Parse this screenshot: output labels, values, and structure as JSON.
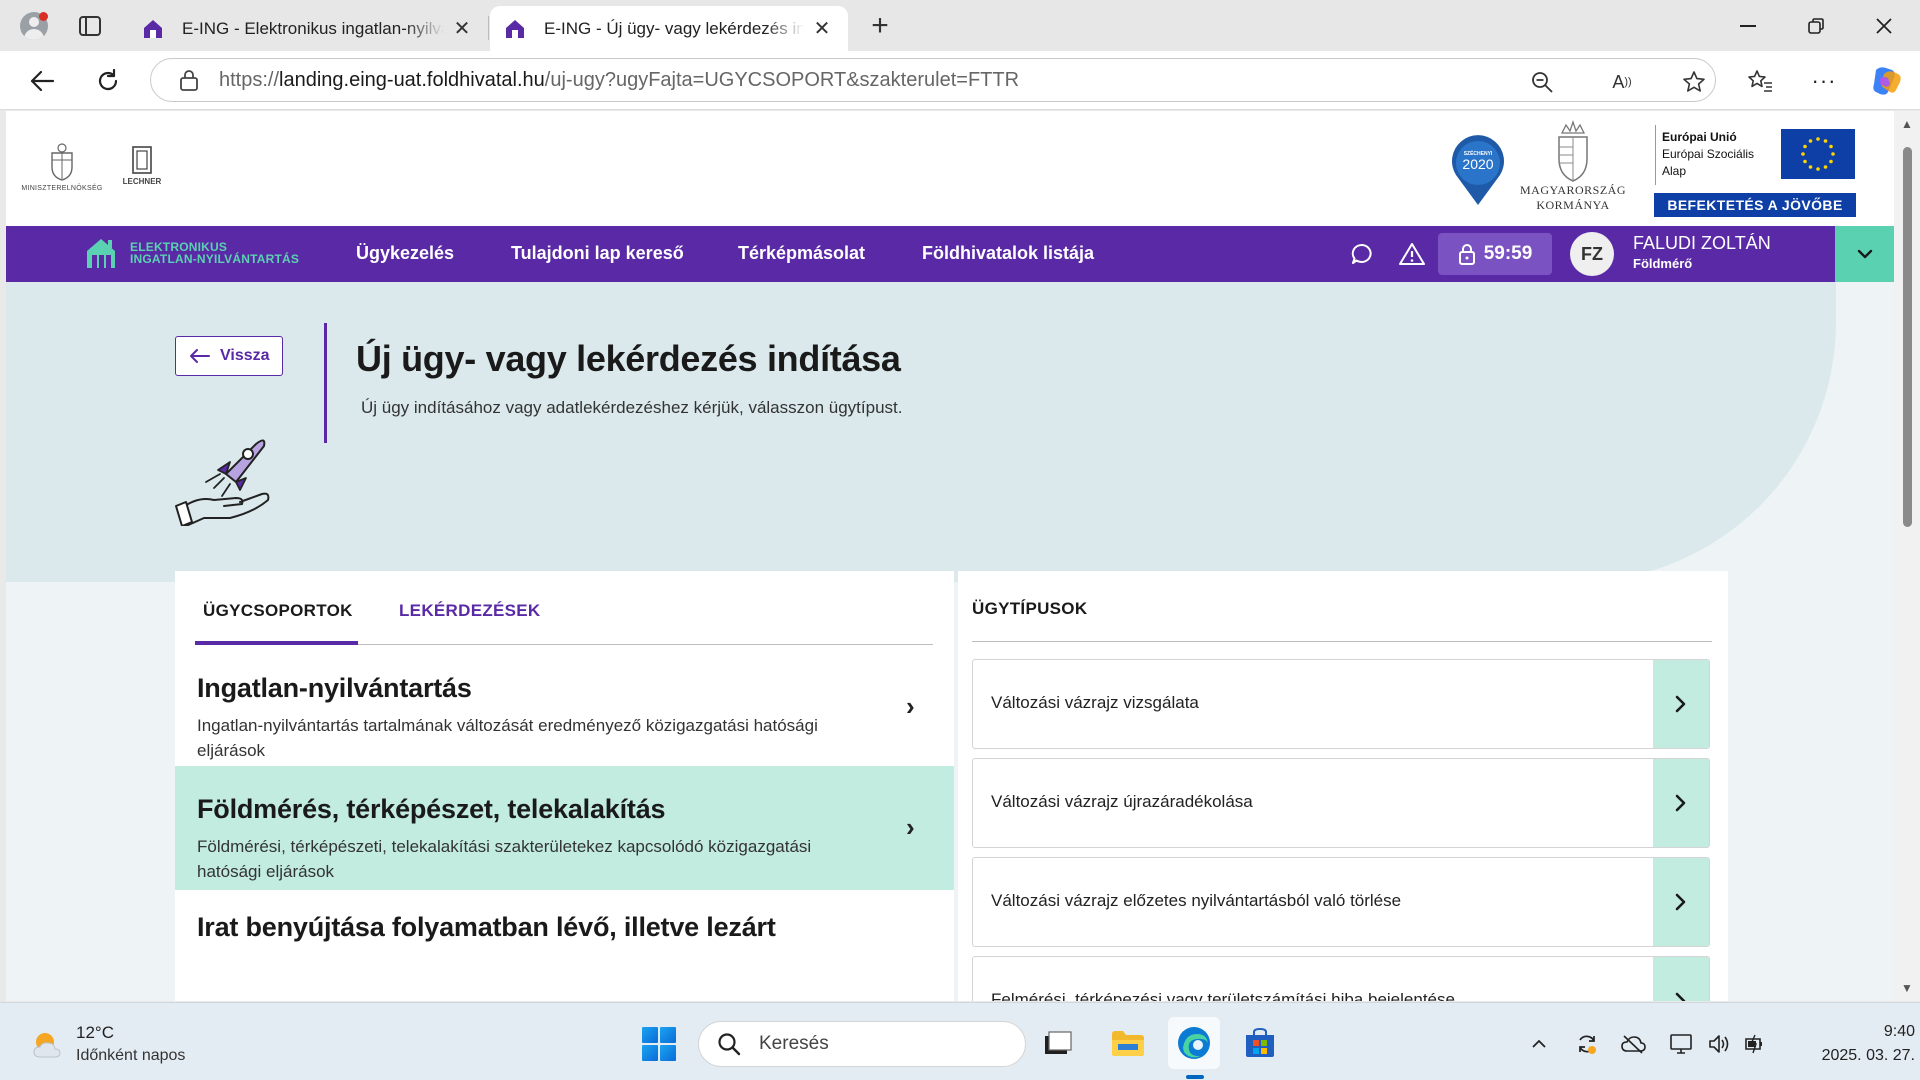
{
  "browser": {
    "tabs": [
      {
        "title": "E-ING - Elektronikus ingatlan-nyilvántartás",
        "active": false
      },
      {
        "title": "E-ING - Új ügy- vagy lekérdezés indítása",
        "active": true
      }
    ],
    "url": {
      "scheme": "https://",
      "host": "landing.eing-uat.foldhivatal.hu",
      "path": "/uj-ugy?ugyFajta=UGYCSOPORT&szakterulet=FTTR"
    }
  },
  "header": {
    "logos": {
      "ministry": "MINISZTERELNÖKSÉG",
      "lechner": "LECHNER",
      "szechenyi_top": "SZÉCHENYI",
      "szechenyi_year": "2020",
      "hungary_gov_line1": "MAGYARORSZÁG",
      "hungary_gov_line2": "KORMÁNYA",
      "eu_line1": "Európai Unió",
      "eu_line2": "Európai Szociális",
      "eu_line3": "Alap",
      "eu_banner": "BEFEKTETÉS A JÖVŐBE"
    }
  },
  "nav": {
    "brand_line1": "ELEKTRONIKUS",
    "brand_line2": "INGATLAN-NYILVÁNTARTÁS",
    "links": [
      "Ügykezelés",
      "Tulajdoni lap kereső",
      "Térképmásolat",
      "Földhivatalok listája"
    ],
    "timer": "59:59",
    "user": {
      "initials": "FZ",
      "name": "FALUDI ZOLTÁN",
      "role": "Földmérő"
    }
  },
  "page": {
    "back_label": "Vissza",
    "title": "Új ügy- vagy lekérdezés indítása",
    "subtitle": "Új ügy indításához vagy adatlekérdezéshez kérjük, válasszon ügytípust."
  },
  "left_panel": {
    "tabs": [
      "ÜGYCSOPORTOK",
      "LEKÉRDEZÉSEK"
    ],
    "groups": [
      {
        "title": "Ingatlan-nyilvántartás",
        "desc": "Ingatlan-nyilvántartás tartalmának változását eredményező közigazgatási hatósági eljárások",
        "selected": false
      },
      {
        "title": "Földmérés, térképészet, telekalakítás",
        "desc": "Földmérési, térképészeti, telekalakítási szakterületekez kapcsolódó közigazgatási hatósági eljárások",
        "selected": true
      },
      {
        "title": "Irat benyújtása folyamatban lévő, illetve lezárt",
        "desc": "",
        "selected": false
      }
    ]
  },
  "right_panel": {
    "title": "ÜGYTÍPUSOK",
    "items": [
      "Változási vázrajz vizsgálata",
      "Változási vázrajz újrazáradékolása",
      "Változási vázrajz előzetes nyilvántartásból való törlése",
      "Felmérési, térképezési vagy területszámítási hiba bejelentése"
    ]
  },
  "taskbar": {
    "weather_temp": "12°C",
    "weather_desc": "Időnként napos",
    "search_placeholder": "Keresés",
    "time": "9:40",
    "date": "2025. 03. 27."
  },
  "colors": {
    "brand_purple": "#5a2aa6",
    "brand_mint": "#5ad1b1",
    "selected_bg": "#c2ece0",
    "page_bg": "#eef3f5"
  }
}
